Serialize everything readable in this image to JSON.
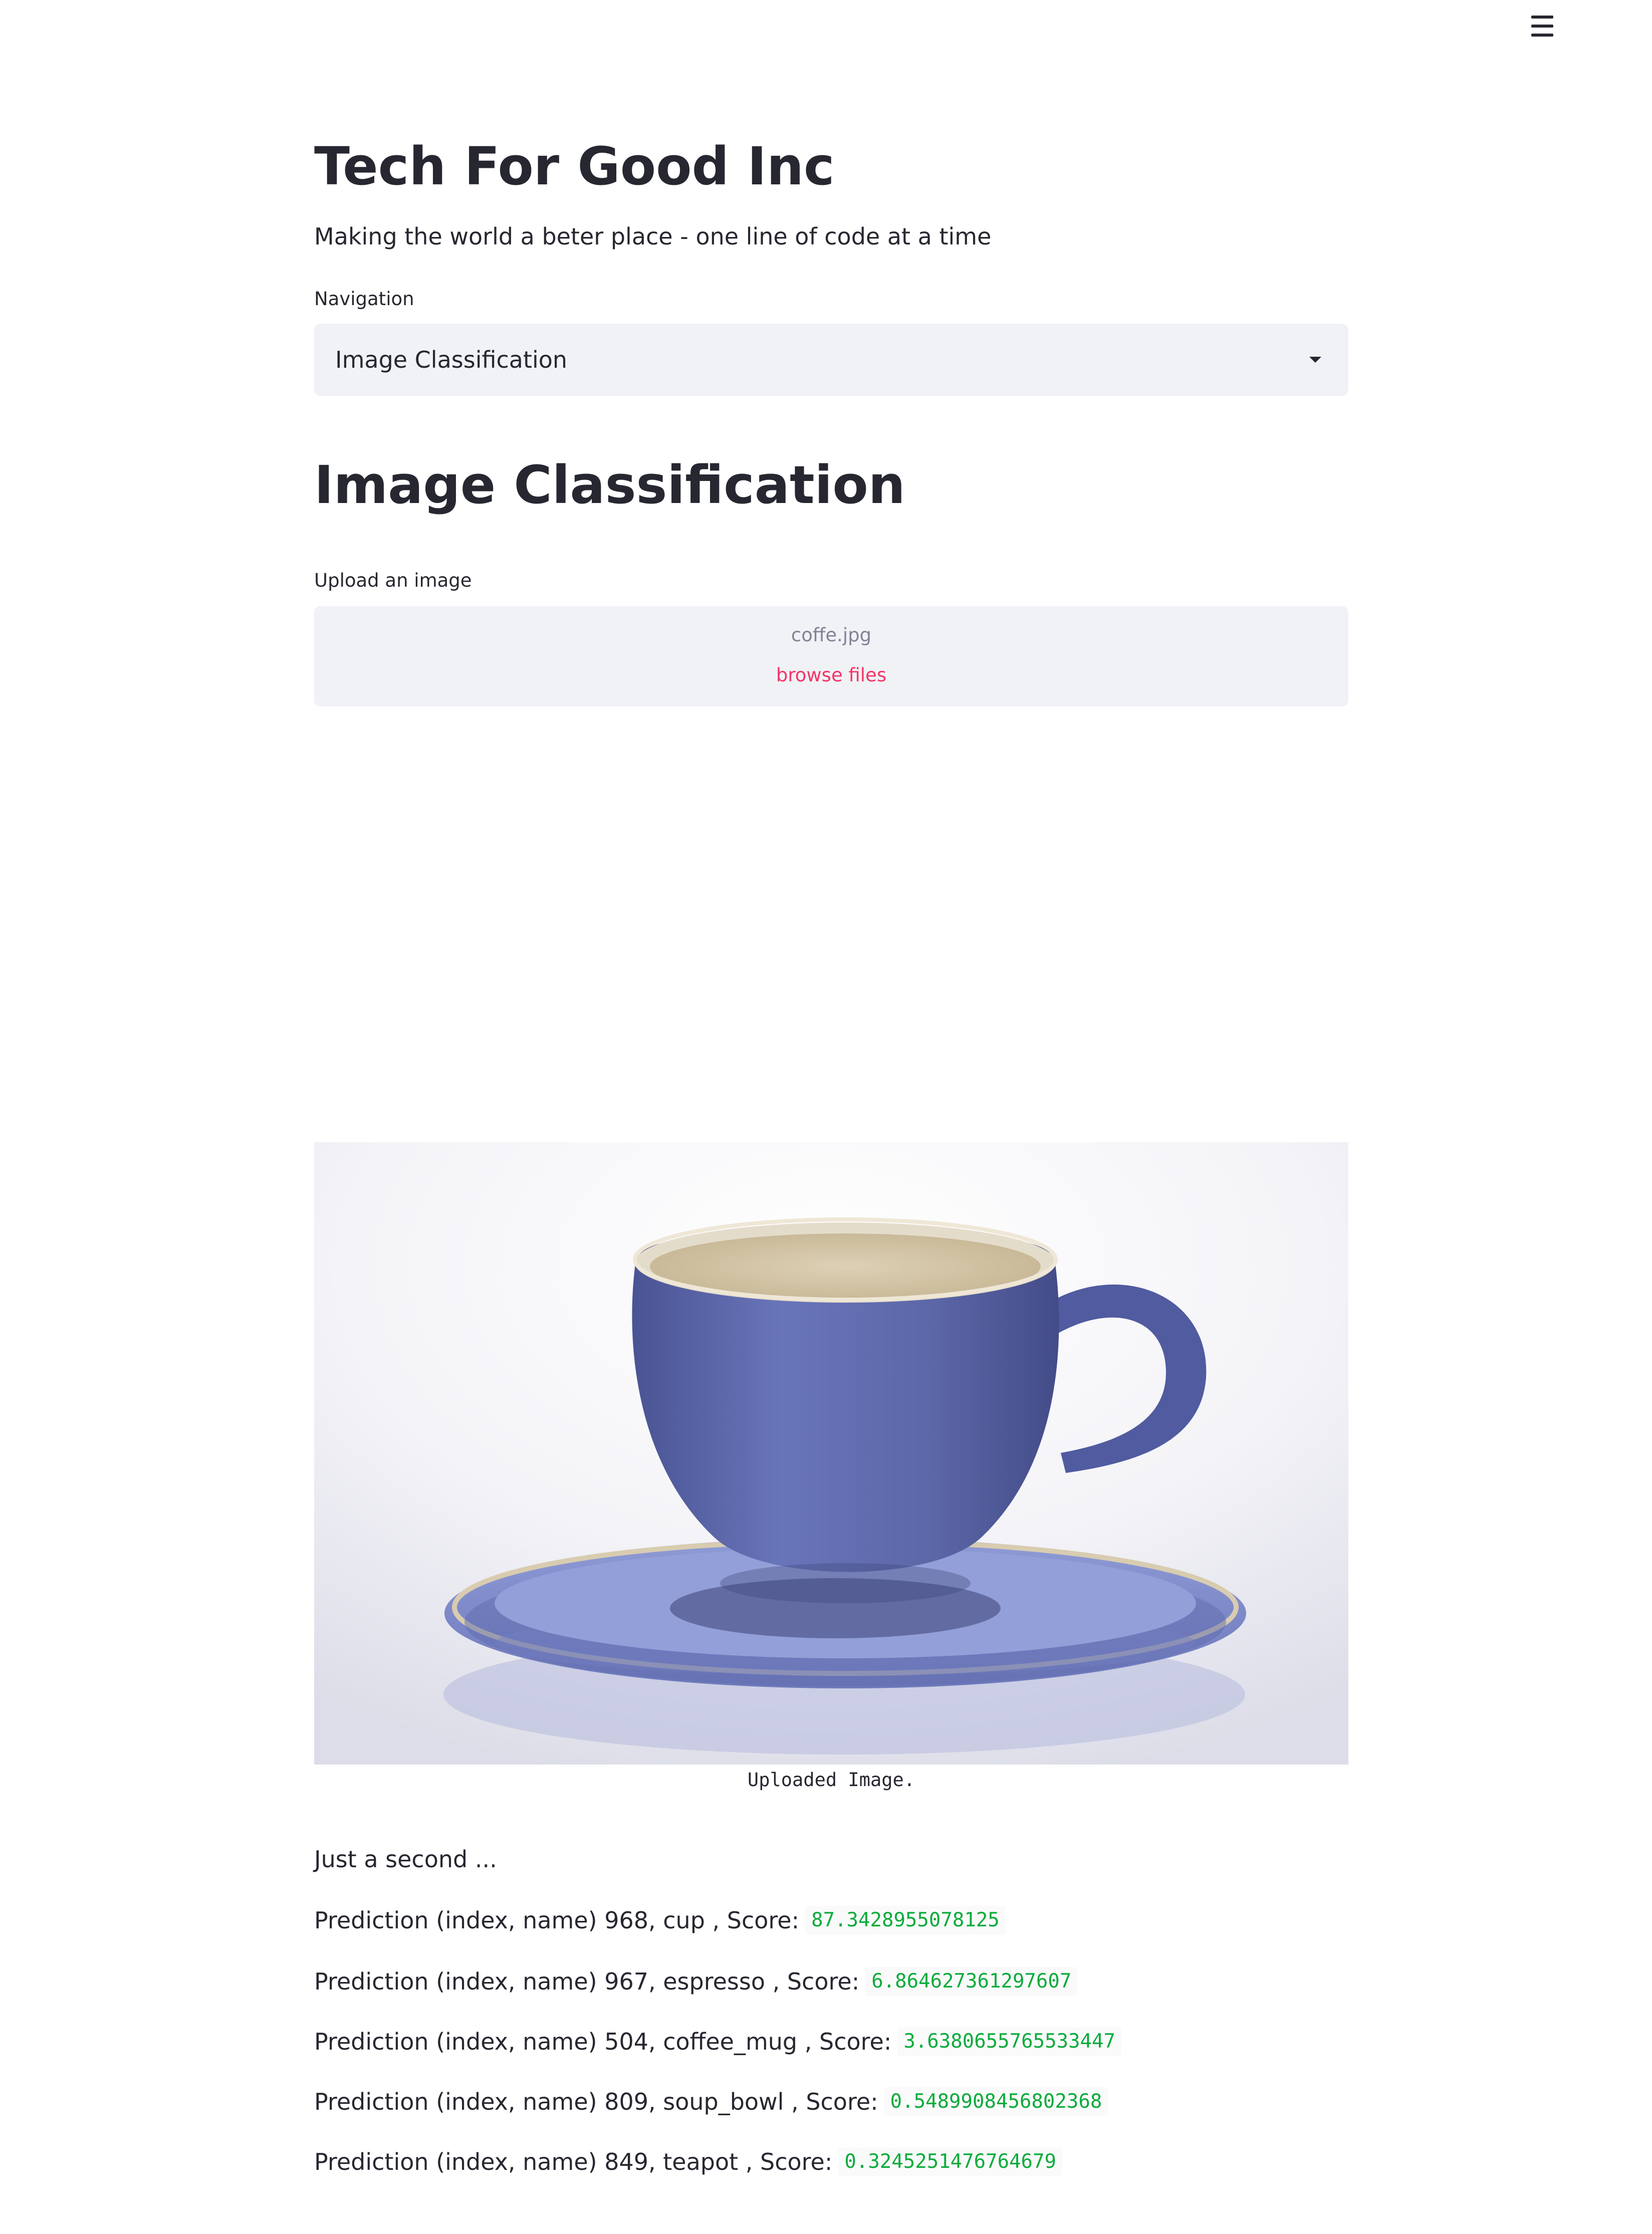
{
  "app": {
    "title": "Tech For Good Inc",
    "subtitle": "Making the world a beter place - one line of code at a time"
  },
  "navigation": {
    "label": "Navigation",
    "selected": "Image Classification"
  },
  "section": {
    "title": "Image Classification"
  },
  "uploader": {
    "label": "Upload an image",
    "filename": "coffe.jpg",
    "browse_label": "browse files"
  },
  "image": {
    "caption": "Uploaded Image."
  },
  "status_text": "Just a second ...",
  "predictions": [
    {
      "text": "Prediction (index, name) 968, cup , Score:",
      "score": "87.3428955078125"
    },
    {
      "text": "Prediction (index, name) 967, espresso , Score:",
      "score": "6.864627361297607"
    },
    {
      "text": "Prediction (index, name) 504, coffee_mug , Score:",
      "score": "3.6380655765533447"
    },
    {
      "text": "Prediction (index, name) 809, soup_bowl , Score:",
      "score": "0.5489908456802368"
    },
    {
      "text": "Prediction (index, name) 849, teapot , Score:",
      "score": "0.3245251476764679"
    }
  ],
  "colors": {
    "accent": "#f63366",
    "score_green": "#09ab3b",
    "widget_bg": "#f0f2f6",
    "cup_blue": "#6673b8"
  }
}
